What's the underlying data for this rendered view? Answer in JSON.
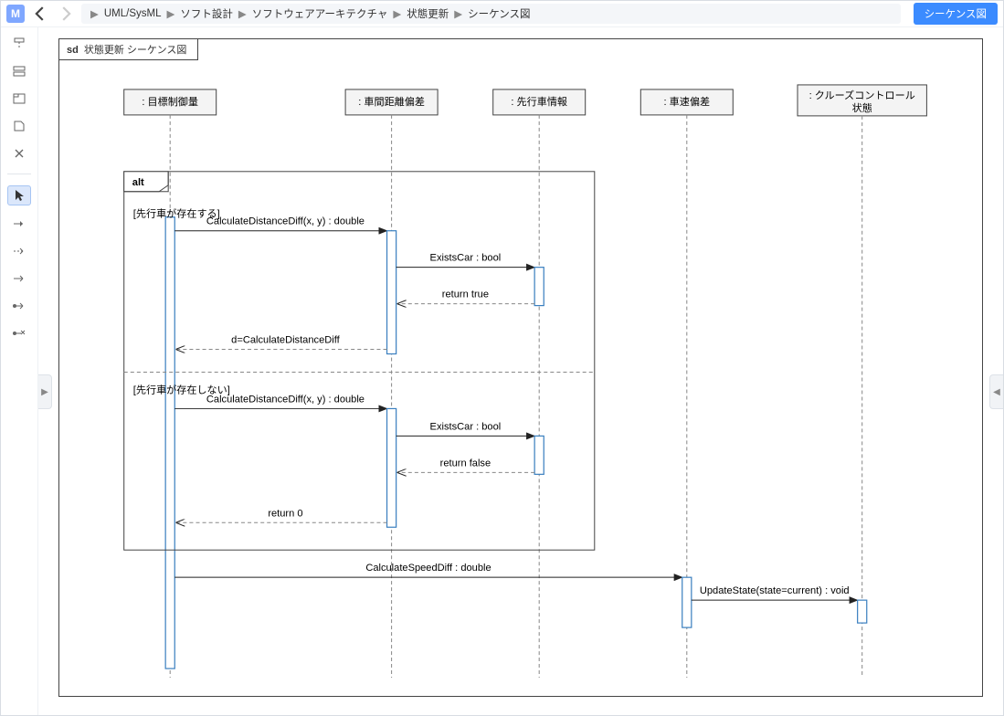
{
  "app_icon_letter": "M",
  "breadcrumb": [
    "UML/SysML",
    "ソフト設計",
    "ソフトウェアアーキテクチャ",
    "状態更新",
    "シーケンス図"
  ],
  "view_pill": "シーケンス図",
  "frame": {
    "kind": "sd",
    "title": "状態更新 シーケンス図"
  },
  "lifelines": [
    {
      "label": ": 目標制御量"
    },
    {
      "label": ": 車間距離偏差"
    },
    {
      "label": ": 先行車情報"
    },
    {
      "label": ": 車速偏差"
    },
    {
      "label": ": クルーズコントロール\n状態"
    }
  ],
  "alt": {
    "operator": "alt",
    "guards": [
      "[先行車が存在する]",
      "[先行車が存在しない]"
    ]
  },
  "messages": {
    "calcDist": "CalculateDistanceDiff(x, y) : double",
    "existsCar": "ExistsCar : bool",
    "retTrue": "return true",
    "dEqCalc": "d=CalculateDistanceDiff",
    "retFalse": "return false",
    "ret0": "return 0",
    "calcSpeed": "CalculateSpeedDiff : double",
    "updateState": "UpdateState(state=current) : void"
  }
}
